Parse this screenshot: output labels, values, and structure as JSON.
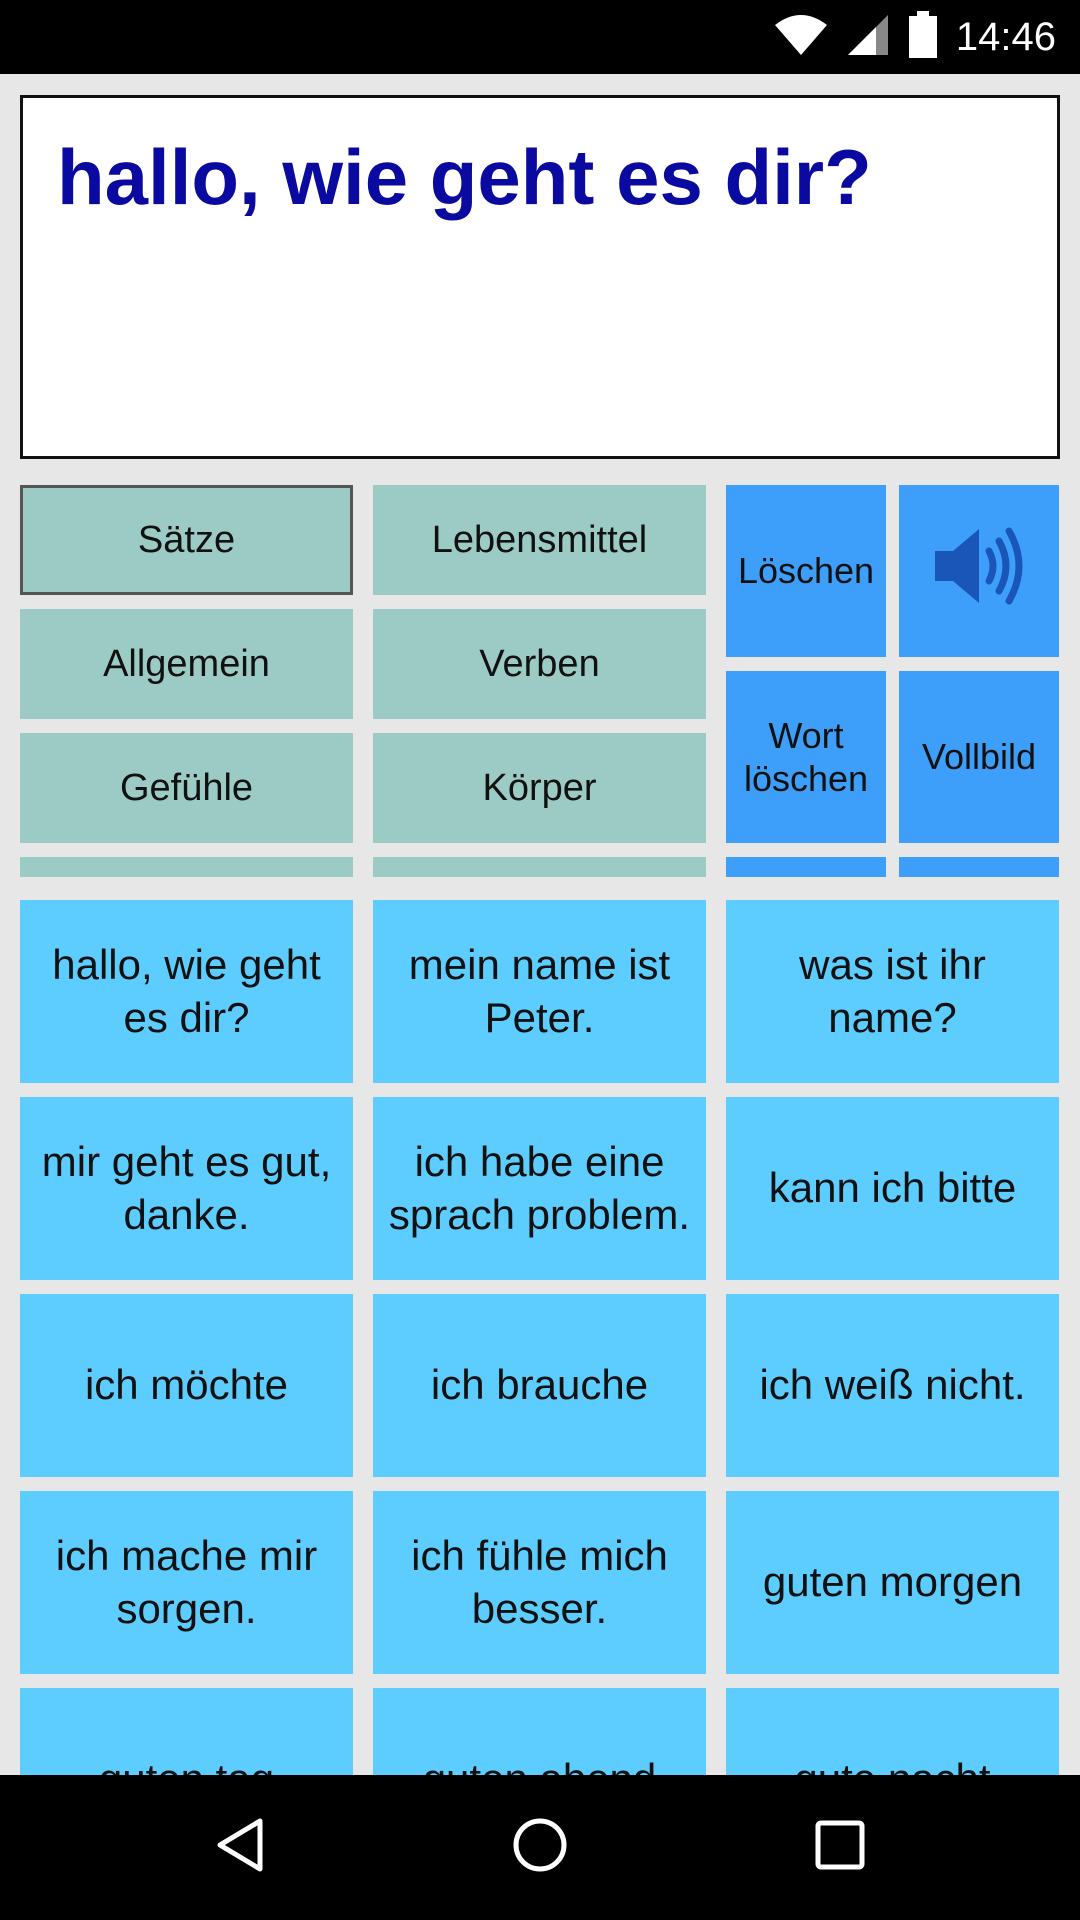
{
  "status_bar": {
    "time": "14:46",
    "icons": [
      "wifi-icon",
      "cell-signal-icon",
      "battery-icon"
    ]
  },
  "display": {
    "text": "hallo, wie geht es dir?"
  },
  "categories": [
    {
      "label": "Sätze",
      "selected": true
    },
    {
      "label": "Lebensmittel",
      "selected": false
    },
    {
      "label": "Allgemein",
      "selected": false
    },
    {
      "label": "Verben",
      "selected": false
    },
    {
      "label": "Gefühle",
      "selected": false
    },
    {
      "label": "Körper",
      "selected": false
    }
  ],
  "actions": {
    "delete_label": "Löschen",
    "delete_word_label": "Wort löschen",
    "fullscreen_label": "Vollbild",
    "speak_icon": "speaker-icon"
  },
  "phrases": [
    "hallo, wie geht es dir?",
    "mein name ist Peter.",
    "was ist ihr name?",
    "mir geht es gut, danke.",
    "ich habe eine sprach problem.",
    "kann ich bitte",
    "ich möchte",
    "ich brauche",
    "ich weiß nicht.",
    "ich mache mir sorgen.",
    "ich fühle mich besser.",
    "guten morgen",
    "guten tag",
    "guten abend",
    "gute nacht"
  ],
  "colors": {
    "display_text": "#0a0aa0",
    "category_bg": "#9ccbc6",
    "action_bg": "#3d9ff9",
    "phrase_bg": "#5dcdff",
    "background": "#e7e7e7"
  },
  "nav_bar": {
    "icons": [
      "back-icon",
      "home-icon",
      "recents-icon"
    ]
  }
}
